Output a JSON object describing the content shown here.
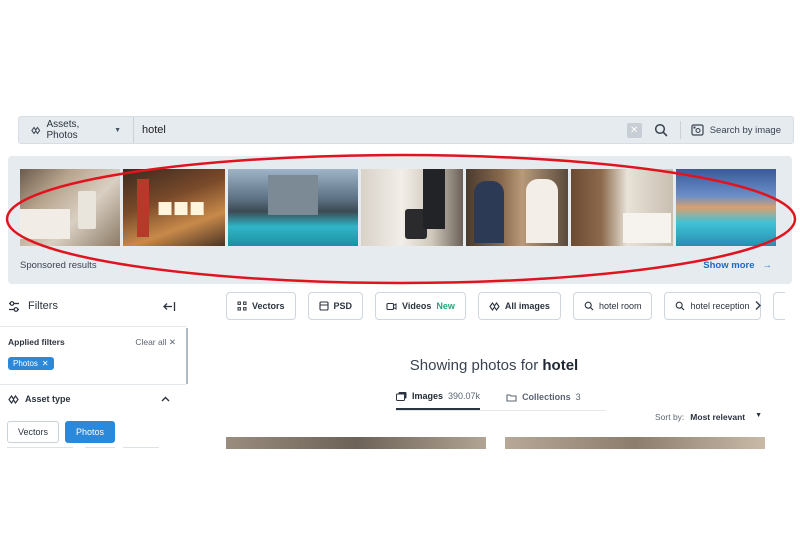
{
  "search": {
    "asset_type": "Assets, Photos",
    "query": "hotel",
    "clear_label": "✕",
    "search_by_image": "Search by image"
  },
  "sponsored": {
    "label": "Sponsored results",
    "show_more": "Show more",
    "arrow": "→"
  },
  "filters": {
    "title": "Filters",
    "applied_title": "Applied filters",
    "clear_all": "Clear all",
    "clear_x": "✕",
    "applied_chip": "Photos",
    "chip_x": "✕",
    "asset_type_title": "Asset type",
    "type_buttons": [
      "Vectors",
      "Photos"
    ]
  },
  "pills": {
    "vectors": "Vectors",
    "psd": "PSD",
    "videos": "Videos",
    "videos_badge": "New",
    "all_images": "All images",
    "hotel_room": "hotel room",
    "hotel_reception": "hotel reception"
  },
  "main": {
    "showing_prefix": "Showing photos for ",
    "showing_query": "hotel",
    "tab_images": "Images",
    "tab_images_count": "390.07k",
    "tab_collections": "Collections",
    "tab_collections_count": "3",
    "sort_label": "Sort by:",
    "sort_value": "Most relevant"
  },
  "colors": {
    "accent": "#2c88d9",
    "link": "#1c6bbf",
    "new_badge": "#27a57a",
    "annotation": "#e0141e"
  }
}
